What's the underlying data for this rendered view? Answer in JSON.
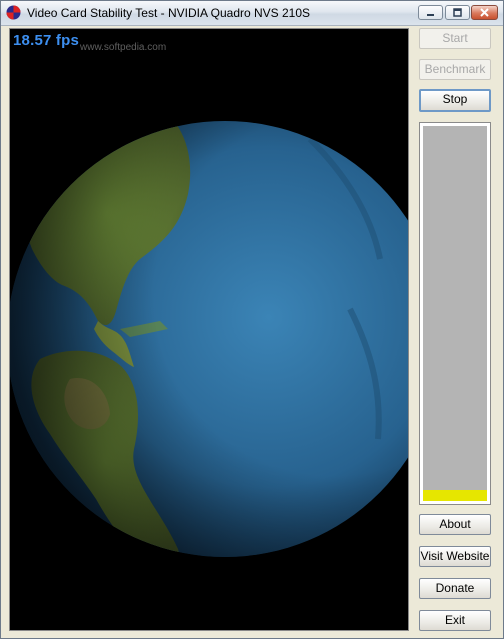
{
  "window": {
    "title": "Video Card Stability Test - NVIDIA Quadro NVS 210S"
  },
  "viewport": {
    "fps_text": "18.57 fps",
    "watermark": "www.softpedia.com"
  },
  "buttons": {
    "start": "Start",
    "benchmark": "Benchmark",
    "stop": "Stop",
    "about": "About",
    "visit_website": "Visit Website",
    "donate": "Donate",
    "exit": "Exit"
  },
  "load_meter": {
    "level_fraction": 0.03,
    "fill_color": "#e6e600",
    "track_color": "#b4b4b4"
  },
  "colors": {
    "fps_text": "#3d8ff0",
    "ocean": "#2d6e9e",
    "land": "#5a7a2c"
  }
}
